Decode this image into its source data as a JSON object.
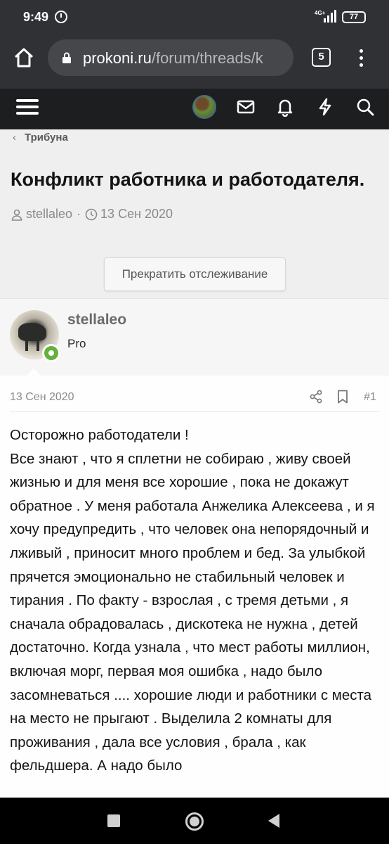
{
  "statusbar": {
    "time": "9:49",
    "network": "4G+",
    "battery": "77",
    "icons": [
      "alarm-icon",
      "signal-icon",
      "battery-icon"
    ]
  },
  "browser": {
    "url_host": "prokoni.ru",
    "url_path": "/forum/threads/k",
    "tab_count": "5",
    "icons": [
      "home-icon",
      "lock-icon",
      "more-vert-icon"
    ]
  },
  "header": {
    "icons": [
      "menu-icon",
      "avatar",
      "mail-icon",
      "bell-icon",
      "bolt-icon",
      "search-icon"
    ]
  },
  "breadcrumb": {
    "label": "Трибуна"
  },
  "thread": {
    "title": "Конфликт работника и работодателя.",
    "author": "stellaleo",
    "separator": "·",
    "date": "13 Сен 2020",
    "unwatch_label": "Прекратить отслеживание"
  },
  "post": {
    "username": "stellaleo",
    "rank": "Pro",
    "date": "13 Сен 2020",
    "number": "#1",
    "body": "Осторожно работодатели !\nВсе знают , что я сплетни не собираю , живу своей жизнью и для меня все хорошие , пока не докажут обратное . У меня работала Анжелика Алексеева , и я хочу предупредить , что человек она непорядочный и лживый , приносит много проблем и бед. За улыбкой прячется эмоционально не стабильный человек и тирания . По факту - взрослая , с тремя детьми , я сначала обрадовалась , дискотека не нужна , детей достаточно. Когда узнала , что мест работы миллион, включая морг, первая моя ошибка , надо было засомневаться .... хорошие люди и работники с места на место не прыгают . Выделила 2 комнаты для проживания , дала все условия , брала , как фельдшера. А надо было"
  },
  "colors": {
    "header_bg": "#1c1e20",
    "browser_bg": "#2f3134",
    "online": "#64b13c"
  }
}
